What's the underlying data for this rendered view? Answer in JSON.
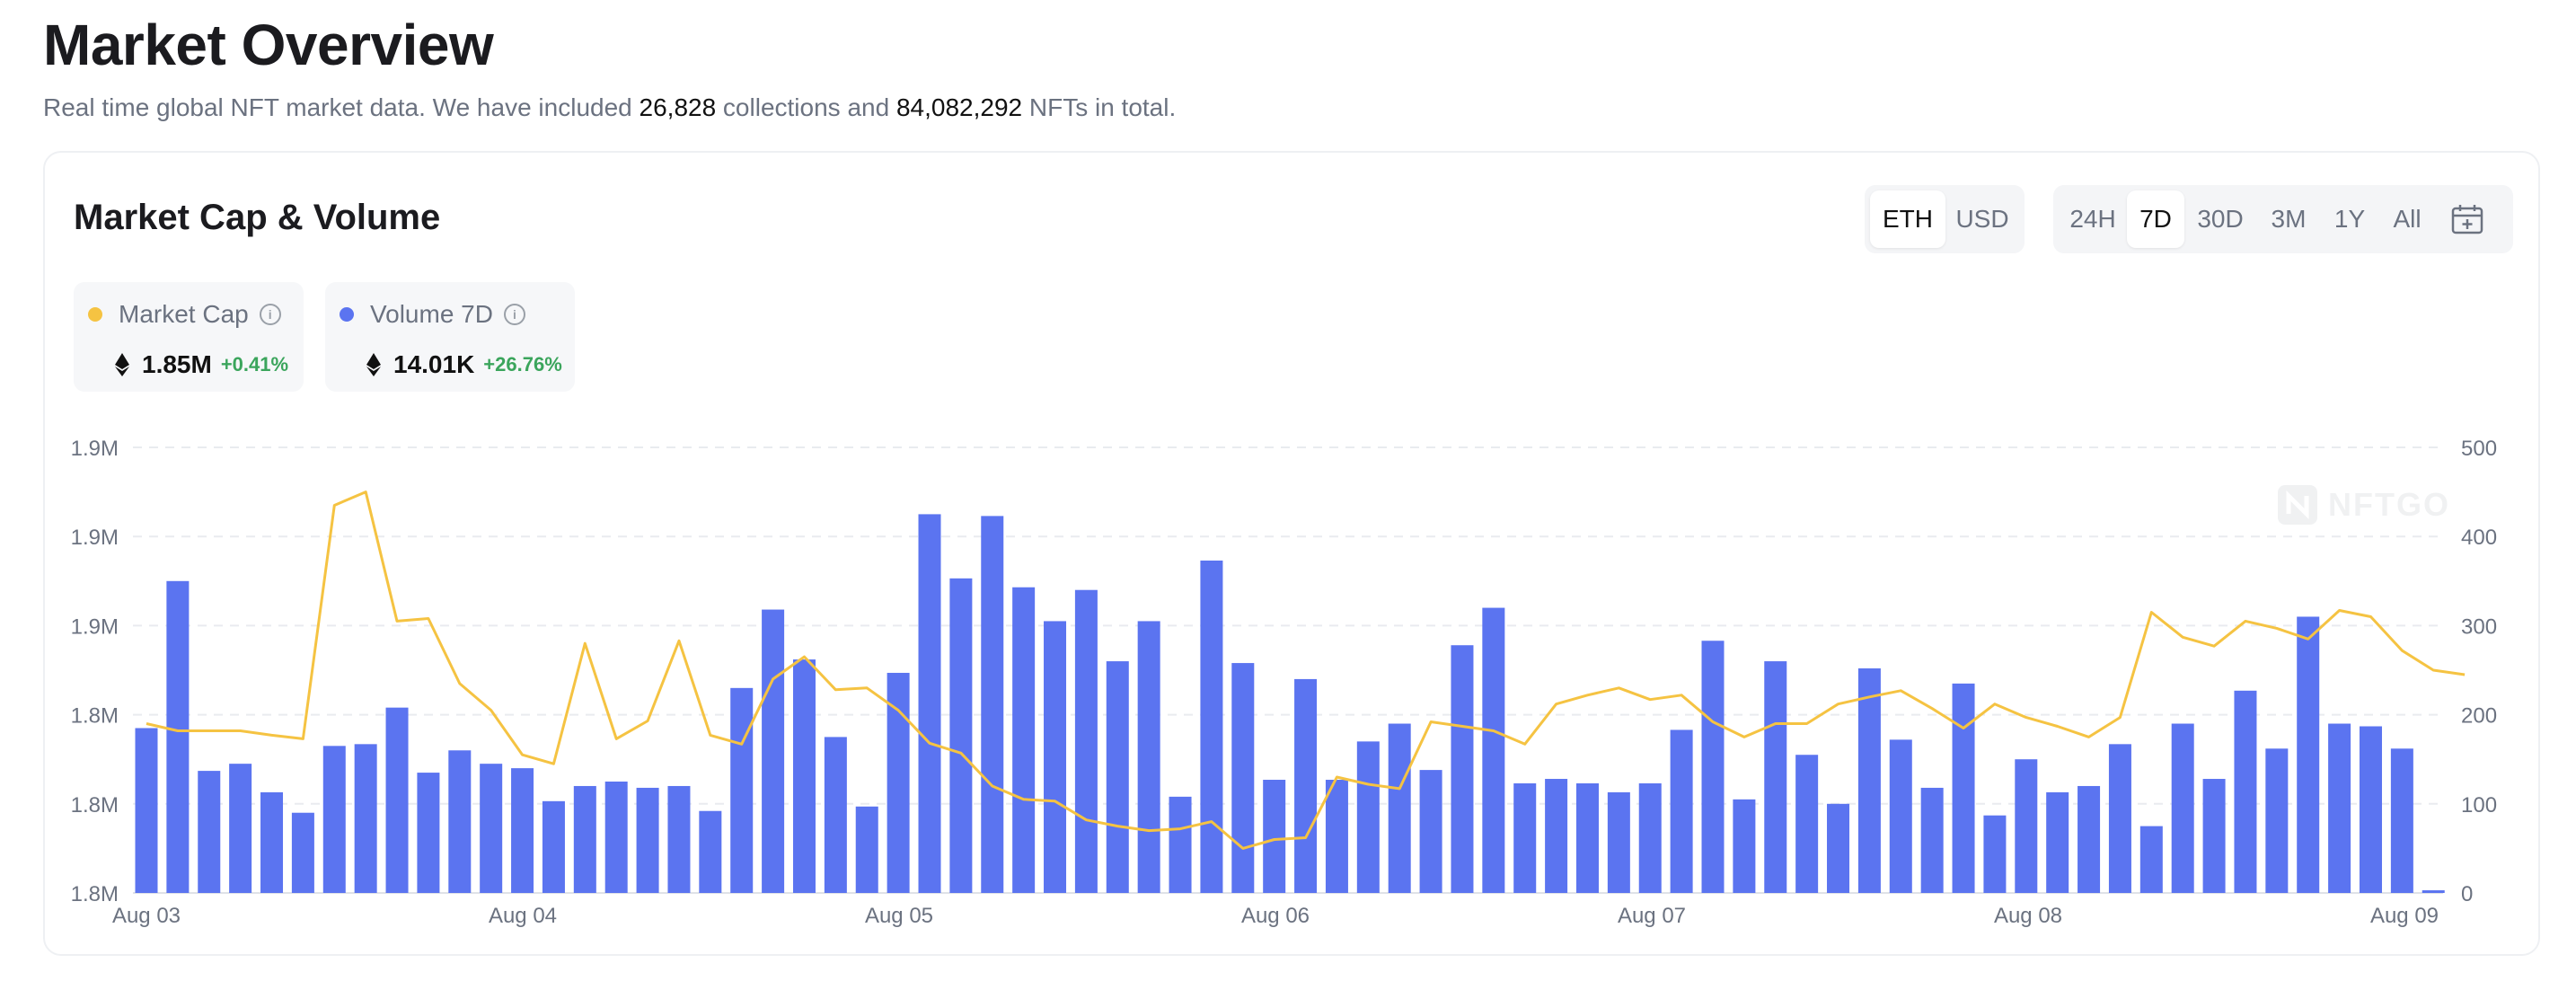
{
  "header": {
    "title": "Market Overview",
    "subtitle_prefix": "Real time global NFT market data. We have included ",
    "collections_count": "26,828",
    "subtitle_mid": " collections and ",
    "nfts_count": "84,082,292",
    "subtitle_suffix": " NFTs in total."
  },
  "card": {
    "title": "Market Cap & Volume",
    "currency_toggle": {
      "options": [
        "ETH",
        "USD"
      ],
      "selected": "ETH"
    },
    "range_toggle": {
      "options": [
        "24H",
        "7D",
        "30D",
        "3M",
        "1Y",
        "All"
      ],
      "selected": "7D"
    },
    "calendar_icon": "calendar-icon",
    "legend": [
      {
        "label": "Market Cap",
        "value": "1.85M",
        "change": "+0.41%",
        "color": "#f5c342"
      },
      {
        "label": "Volume 7D",
        "value": "14.01K",
        "change": "+26.76%",
        "color": "#5b74f0"
      }
    ],
    "watermark": "NFTGO"
  },
  "chart_data": {
    "type": "bar",
    "x_ticks": [
      "Aug 03",
      "Aug 04",
      "Aug 05",
      "Aug 06",
      "Aug 07",
      "Aug 08",
      "Aug 09"
    ],
    "y_left_ticks": [
      "1.8M",
      "1.8M",
      "1.8M",
      "1.9M",
      "1.9M",
      "1.9M"
    ],
    "y_right_ticks": [
      "0",
      "100",
      "200",
      "300",
      "400",
      "500"
    ],
    "y_right_range": [
      0,
      500
    ],
    "grid": "horizontal dashed",
    "series": [
      {
        "name": "Volume 7D",
        "type": "bar",
        "axis": "right",
        "color": "#5b74f0",
        "values": [
          185,
          350,
          137,
          145,
          113,
          90,
          165,
          167,
          208,
          135,
          160,
          145,
          140,
          103,
          120,
          125,
          118,
          120,
          92,
          230,
          318,
          262,
          175,
          97,
          247,
          425,
          353,
          423,
          343,
          305,
          340,
          260,
          305,
          108,
          373,
          258,
          127,
          240,
          127,
          170,
          190,
          138,
          278,
          320,
          123,
          128,
          123,
          113,
          123,
          183,
          283,
          105,
          260,
          155,
          100,
          252,
          172,
          118,
          235,
          87,
          150,
          113,
          120,
          167,
          75,
          190,
          128,
          227,
          162,
          310,
          190,
          187,
          162,
          3
        ]
      },
      {
        "name": "Market Cap",
        "type": "line",
        "axis": "left",
        "color": "#f5c342",
        "values": [
          190,
          182,
          182,
          182,
          177,
          173,
          435,
          450,
          305,
          308,
          235,
          205,
          155,
          145,
          280,
          173,
          193,
          283,
          177,
          167,
          240,
          265,
          228,
          230,
          205,
          168,
          157,
          120,
          105,
          103,
          82,
          75,
          70,
          72,
          80,
          50,
          60,
          62,
          130,
          122,
          117,
          192,
          187,
          182,
          167,
          212,
          222,
          230,
          217,
          222,
          192,
          175,
          190,
          190,
          212,
          220,
          227,
          207,
          185,
          212,
          197,
          187,
          175,
          197,
          315,
          287,
          277,
          305,
          297,
          285,
          317,
          310,
          272,
          250,
          245
        ]
      }
    ]
  }
}
